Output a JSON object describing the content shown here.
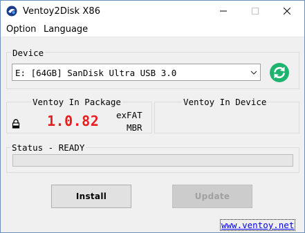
{
  "window": {
    "title": "Ventoy2Disk  X86"
  },
  "menu": {
    "items": [
      "Option",
      "Language"
    ]
  },
  "device": {
    "group_label": "Device",
    "selected": "E: [64GB] SanDisk Ultra USB 3.0",
    "refresh_icon": "refresh-icon"
  },
  "package": {
    "group_label": "Ventoy In Package",
    "version": "1.0.82",
    "filesystem": "exFAT",
    "partition_style": "MBR"
  },
  "device_info": {
    "group_label": "Ventoy In Device"
  },
  "status": {
    "label": "Status - READY",
    "progress_percent": 0
  },
  "buttons": {
    "install": "Install",
    "update": "Update"
  },
  "footer": {
    "link": "www.ventoy.net"
  },
  "colors": {
    "version_red": "#e81e1e",
    "refresh_green": "#1fb370",
    "link_blue": "#0000ee"
  }
}
